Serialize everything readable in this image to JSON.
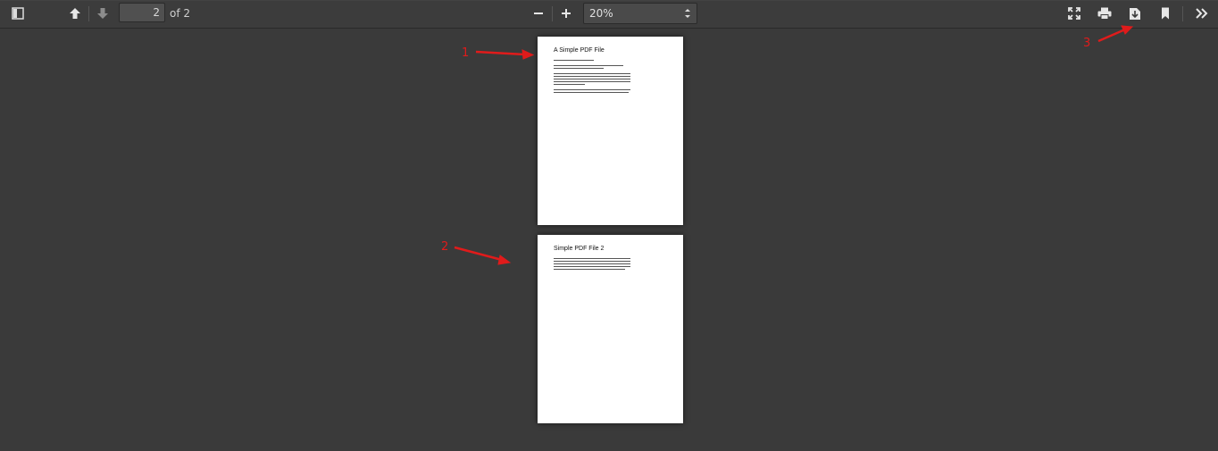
{
  "toolbar": {
    "page_current": "2",
    "page_total_label": "of 2",
    "zoom_value": "20%",
    "icons": {
      "sidebar_toggle": "sidebar-toggle-icon",
      "previous_page": "arrow-up-icon",
      "next_page": "arrow-down-icon",
      "zoom_out": "minus-icon",
      "zoom_in": "plus-icon",
      "presentation": "fullscreen-icon",
      "print": "print-icon",
      "download": "download-icon",
      "bookmark": "bookmark-icon",
      "tools": "double-chevron-right-icon"
    }
  },
  "pages": [
    {
      "title": "A Simple PDF File"
    },
    {
      "title": "Simple PDF File 2"
    }
  ],
  "annotations": [
    {
      "label": "1"
    },
    {
      "label": "2"
    },
    {
      "label": "3"
    }
  ],
  "colors": {
    "background": "#3a3a3a",
    "toolbar": "#3c3c3c",
    "annotation": "#e01b1b",
    "page": "#ffffff"
  }
}
